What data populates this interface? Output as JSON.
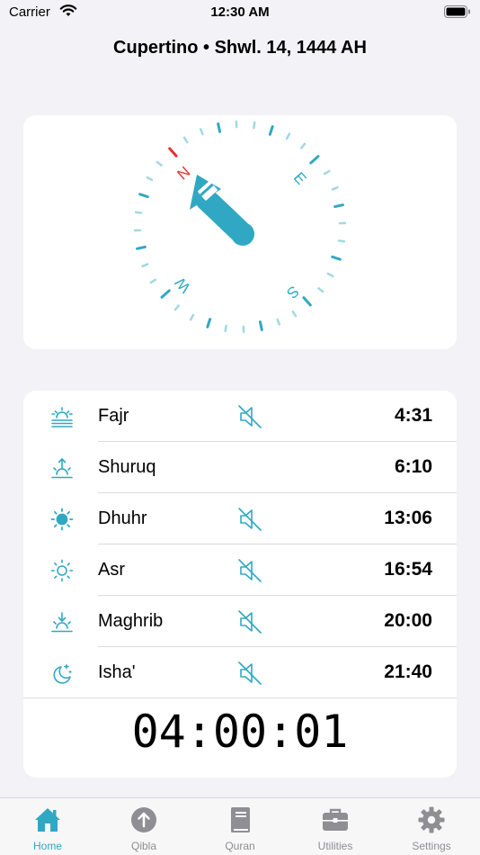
{
  "status_bar": {
    "carrier": "Carrier",
    "time": "12:30 AM"
  },
  "header": {
    "title": "Cupertino • Shwl. 14, 1444 AH"
  },
  "compass": {
    "north": "N",
    "east": "E",
    "south": "S",
    "west": "W",
    "accent_color": "#30a8c3",
    "north_color": "#e8312f"
  },
  "prayers": [
    {
      "name": "Fajr",
      "time": "4:31",
      "icon": "sunrise-lines-icon",
      "muted": true
    },
    {
      "name": "Shuruq",
      "time": "6:10",
      "icon": "sunrise-up-icon",
      "muted": false
    },
    {
      "name": "Dhuhr",
      "time": "13:06",
      "icon": "sun-filled-icon",
      "muted": true
    },
    {
      "name": "Asr",
      "time": "16:54",
      "icon": "sun-outline-icon",
      "muted": true
    },
    {
      "name": "Maghrib",
      "time": "20:00",
      "icon": "sunset-down-icon",
      "muted": true
    },
    {
      "name": "Isha'",
      "time": "21:40",
      "icon": "moon-stars-icon",
      "muted": true
    }
  ],
  "countdown": "04:00:01",
  "tabs": [
    {
      "label": "Home",
      "icon": "house-icon",
      "active": true
    },
    {
      "label": "Qibla",
      "icon": "arrow-up-circle-icon",
      "active": false
    },
    {
      "label": "Quran",
      "icon": "book-icon",
      "active": false
    },
    {
      "label": "Utilities",
      "icon": "briefcase-icon",
      "active": false
    },
    {
      "label": "Settings",
      "icon": "gear-icon",
      "active": false
    }
  ],
  "colors": {
    "accent": "#30a8c3",
    "tab_inactive": "#8e8e93",
    "background": "#f2f2f7"
  }
}
